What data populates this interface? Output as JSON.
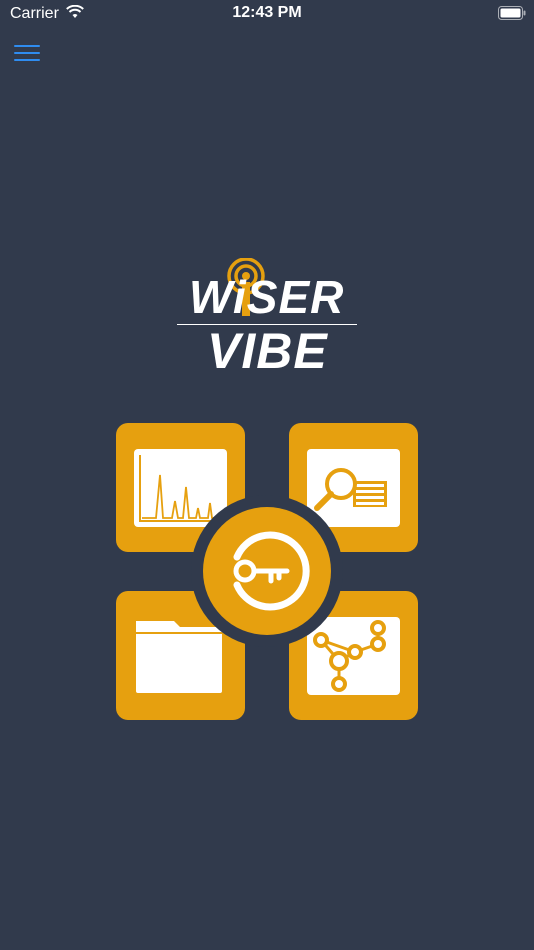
{
  "status_bar": {
    "carrier": "Carrier",
    "time": "12:43 PM"
  },
  "logo": {
    "line1": "WiSER",
    "line2": "VIBE"
  },
  "colors": {
    "background": "#313a4c",
    "accent": "#e6a00f",
    "menu": "#2f8cf0",
    "tile_inner": "#ffffff"
  },
  "icons": {
    "menu": "hamburger-menu-icon",
    "top_left": "spectrum-chart-icon",
    "top_right": "search-document-icon",
    "center": "key-login-icon",
    "bottom_left": "folder-icon",
    "bottom_right": "network-graph-icon"
  }
}
